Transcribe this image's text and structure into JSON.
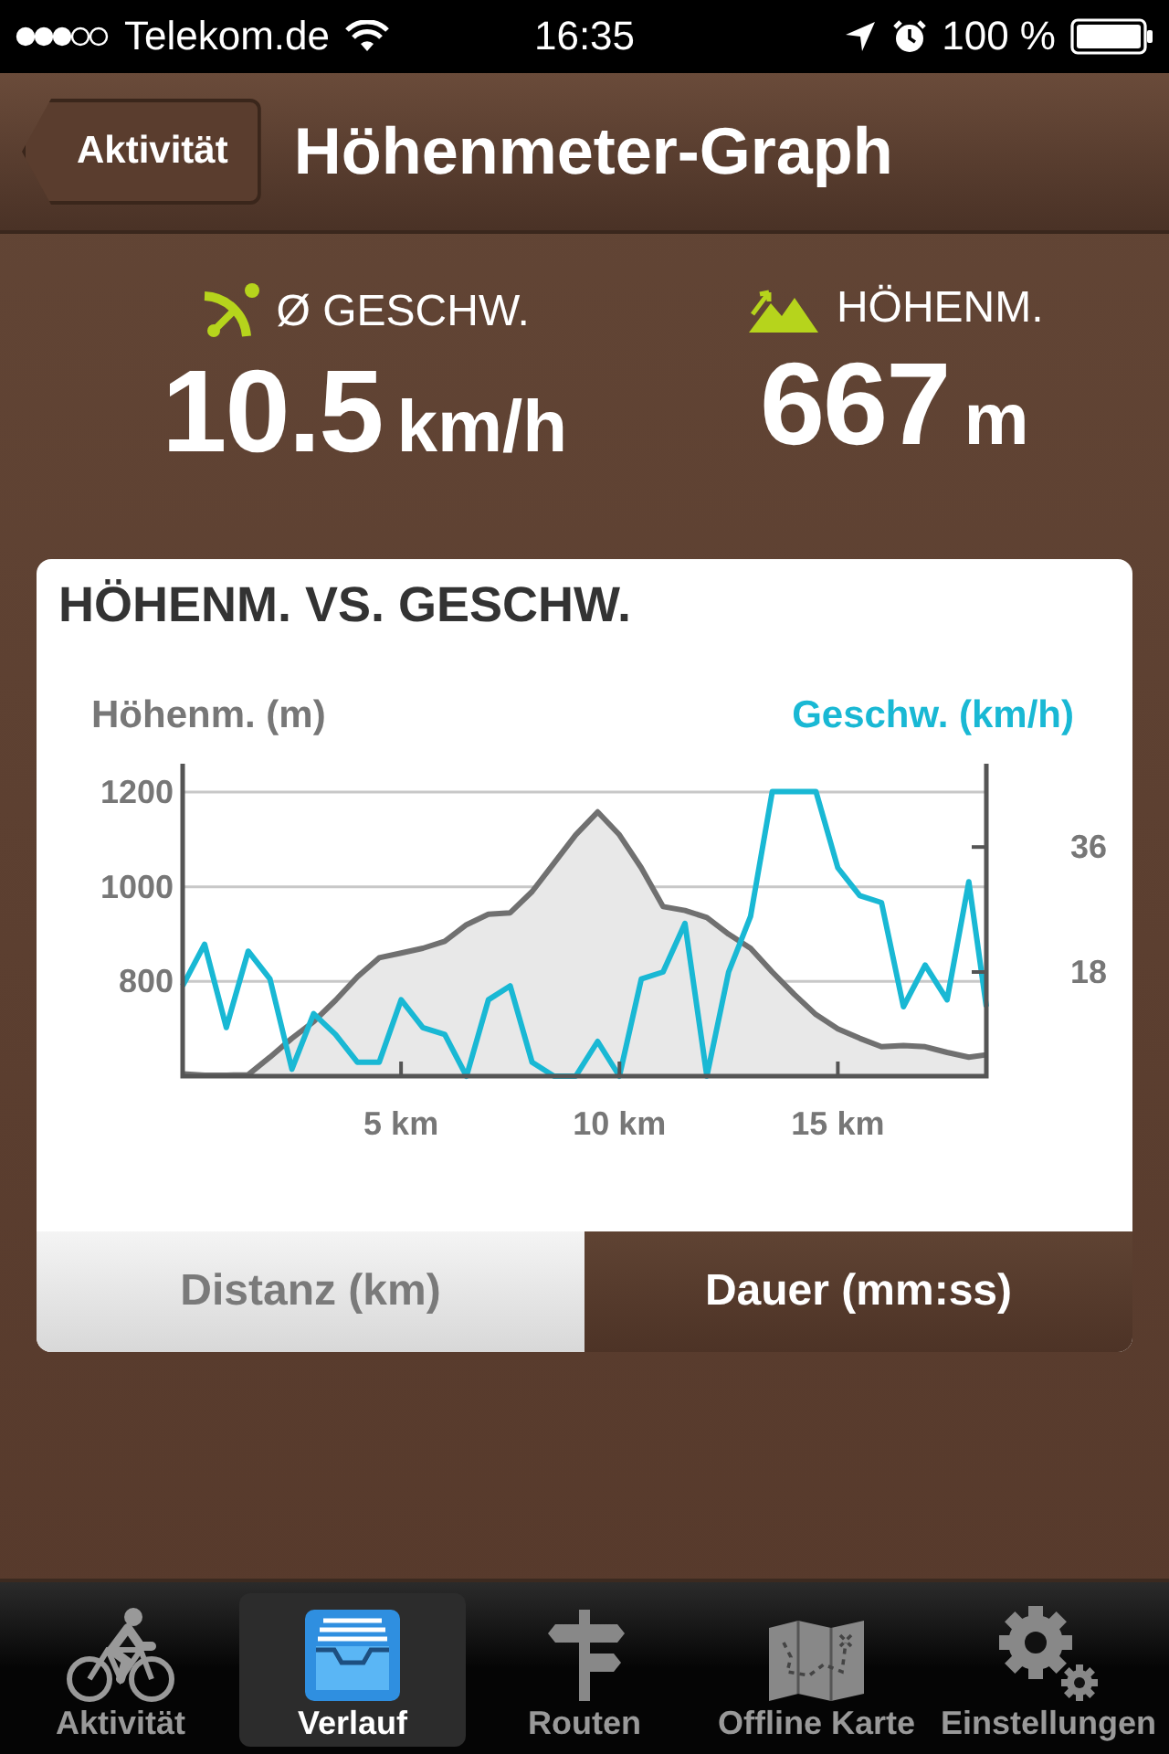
{
  "status_bar": {
    "carrier": "Telekom.de",
    "time": "16:35",
    "battery": "100 %"
  },
  "nav_bar": {
    "back_button": "Aktivität",
    "title": "Höhenmeter-Graph"
  },
  "stats": [
    {
      "kind": "speed",
      "label": "Ø GESCHW.",
      "value": "10.5",
      "unit": "km/h"
    },
    {
      "kind": "elevation",
      "label": "HÖHENM.",
      "value": "667",
      "unit": "m"
    }
  ],
  "card": {
    "title": "HÖHENM. VS. GESCHW.",
    "chart_data": {
      "type": "line",
      "ylabel": "Höhenm. (m)",
      "y2label": "Geschw. (km/h)",
      "x": [
        0,
        0.5,
        1,
        1.5,
        2,
        2.5,
        3,
        3.5,
        4,
        4.5,
        5,
        5.5,
        6,
        6.5,
        7,
        7.5,
        8,
        8.5,
        9,
        9.5,
        10,
        10.5,
        11,
        11.5,
        12,
        12.5,
        13,
        13.5,
        14,
        14.5,
        15,
        15.5,
        16,
        16.5,
        17,
        17.5,
        18,
        18.4
      ],
      "xlim": [
        0,
        18.4
      ],
      "ylim": [
        600,
        1260
      ],
      "y2lim": [
        3,
        48
      ],
      "xticks": [
        {
          "value": 5,
          "label": "5 km"
        },
        {
          "value": 10,
          "label": "10 km"
        },
        {
          "value": 15,
          "label": "15 km"
        }
      ],
      "yticks": [
        800,
        1000,
        1200
      ],
      "grid": true,
      "y2ticks": [
        18,
        36
      ],
      "series": [
        {
          "color": "#707070",
          "values": [
            605,
            602,
            602,
            603,
            640,
            680,
            715,
            760,
            810,
            850,
            860,
            870,
            885,
            920,
            942,
            945,
            990,
            1050,
            1110,
            1158,
            1110,
            1040,
            958,
            950,
            935,
            900,
            870,
            820,
            773,
            730,
            700,
            680,
            662,
            665,
            662,
            650,
            640,
            645
          ]
        },
        {
          "color": "#19b8d4",
          "axis": "y2",
          "values": [
            16,
            22,
            10,
            21,
            17,
            4,
            12,
            9,
            5,
            5,
            14,
            10,
            9,
            3,
            14,
            16,
            5,
            3,
            3,
            8,
            3,
            17,
            18,
            25,
            3,
            18,
            26,
            44,
            44,
            44,
            33,
            29,
            28,
            13,
            19,
            14,
            31,
            13
          ]
        }
      ]
    },
    "segments": [
      {
        "label": "Distanz (km)",
        "selected": true
      },
      {
        "label": "Dauer (mm:ss)",
        "selected": false
      }
    ]
  },
  "tab_bar": [
    {
      "kind": "bike",
      "label": "Aktivität",
      "selected": false
    },
    {
      "kind": "history",
      "label": "Verlauf",
      "selected": true
    },
    {
      "kind": "routes",
      "label": "Routen",
      "selected": false
    },
    {
      "kind": "map",
      "label": "Offline Karte",
      "selected": false
    },
    {
      "kind": "settings",
      "label": "Einstellungen",
      "selected": false
    }
  ]
}
